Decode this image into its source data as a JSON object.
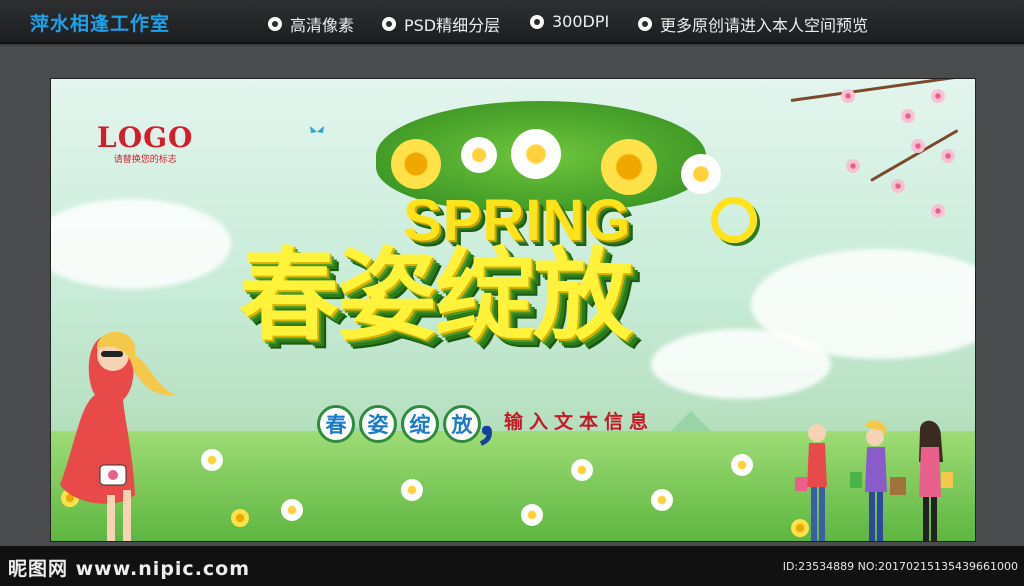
{
  "header": {
    "studio_name": "萍水相逢工作室",
    "features": [
      "高清像素",
      "PSD精细分层",
      "300DPI",
      "更多原创请进入本人空间预览"
    ]
  },
  "poster": {
    "logo_text": "LOGO",
    "logo_subtext": "请替换您的标志",
    "english_title": "SPRING",
    "headline": "春姿绽放",
    "sub_chars": [
      "春",
      "姿",
      "绽",
      "放"
    ],
    "comma": "，",
    "sub_text": "输入文本信息"
  },
  "footer": {
    "site": "昵图网 www.nipic.com",
    "ids": "ID:23534889 NO:20170215135439661000"
  },
  "colors": {
    "headline_yellow": "#fff23a",
    "accent_green": "#2d7a1b",
    "studio_blue": "#1da1e8",
    "subtext_red": "#c41a28"
  }
}
